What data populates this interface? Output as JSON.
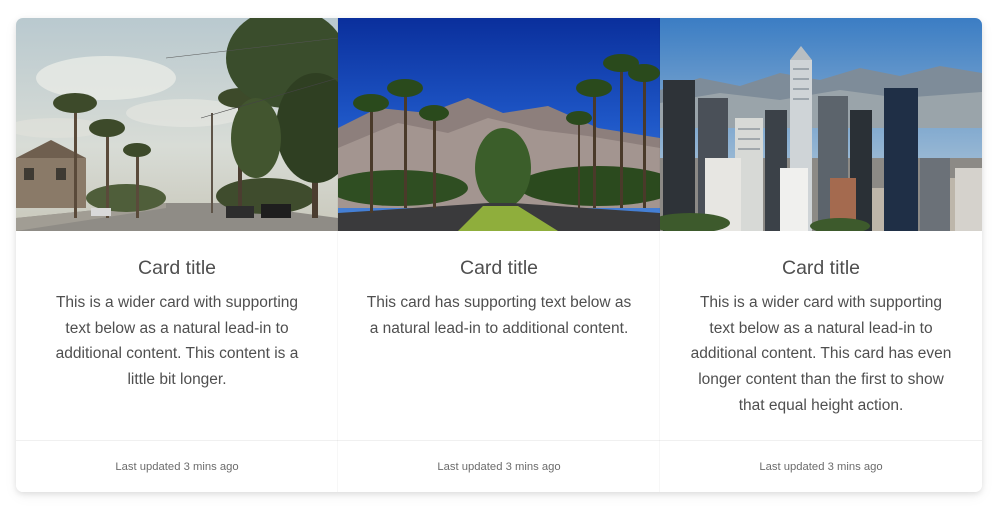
{
  "cards": [
    {
      "image": "palm-tree-street-photo",
      "title": "Card title",
      "text": "This is a wider card with supporting text below as a natural lead-in to additional content. This content is a little bit longer.",
      "footer": "Last updated 3 mins ago"
    },
    {
      "image": "palm-avenue-mountains-photo",
      "title": "Card title",
      "text": "This card has supporting text below as a natural lead-in to additional content.",
      "footer": "Last updated 3 mins ago"
    },
    {
      "image": "city-skyline-photo",
      "title": "Card title",
      "text": "This is a wider card with supporting text below as a natural lead-in to additional content. This card has even longer content than the first to show that equal height action.",
      "footer": "Last updated 3 mins ago"
    }
  ]
}
